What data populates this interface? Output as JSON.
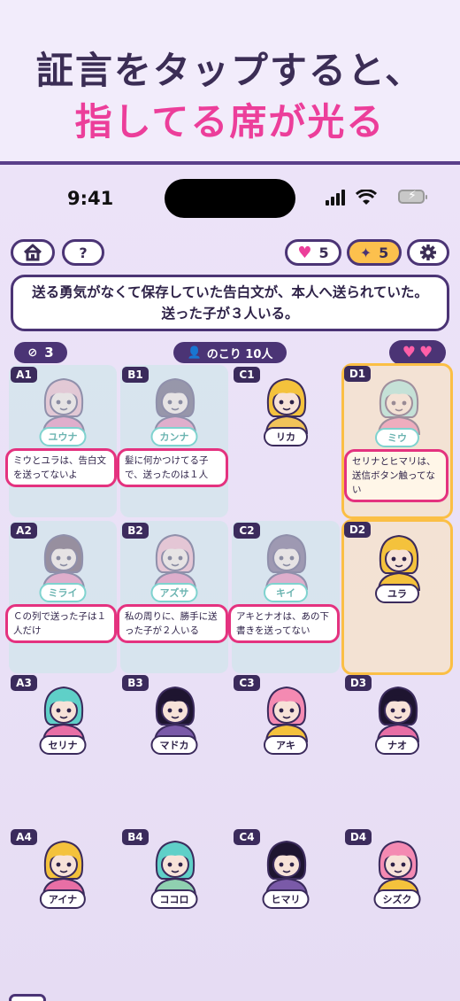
{
  "promo": {
    "line1": "証言をタップすると、",
    "line2": "指してる席が光る"
  },
  "status_bar": {
    "time": "9:41"
  },
  "toolbar": {
    "home_icon": "home-icon",
    "help_label": "?",
    "lives_value": "5",
    "hints_value": "5",
    "settings_icon": "gear-icon"
  },
  "prompt": {
    "text": "送る勇気がなくて保存していた告白文が、本人へ送られていた。送った子が３人いる。"
  },
  "counters": {
    "marked_value": "3",
    "remaining_label": "のこり 10人"
  },
  "hearts": [
    "♥",
    "♥"
  ],
  "seats": [
    {
      "id": "A1",
      "name": "ユウナ",
      "testimony": "ミウとユラは、告白文を送ってないよ",
      "viewed": true,
      "hair": "#f0a8b8",
      "skin": "#f7e2d8",
      "shirt": "#e86fa5"
    },
    {
      "id": "B1",
      "name": "カンナ",
      "testimony": "髪に何かつけてる子で、送ったのは１人",
      "viewed": true,
      "hair": "#4a3a5a",
      "skin": "#f7e2d8",
      "shirt": "#e86fa5"
    },
    {
      "id": "C1",
      "name": "リカ",
      "testimony": "",
      "viewed": false,
      "hair": "#f4c23c",
      "skin": "#f7e2d8",
      "shirt": "#f1c35a"
    },
    {
      "id": "D1",
      "name": "ミウ",
      "testimony": "セリナとヒマリは、送信ボタン触ってない",
      "viewed": true,
      "highlight": true,
      "hair": "#8fe0dc",
      "skin": "#f7e2d8",
      "shirt": "#e86fa5"
    },
    {
      "id": "A2",
      "name": "ミライ",
      "testimony": "Ｃの列で送った子は１人だけ",
      "viewed": true,
      "hair": "#4a2a40",
      "skin": "#f7e2d8",
      "shirt": "#e86fa5"
    },
    {
      "id": "B2",
      "name": "アズサ",
      "testimony": "私の周りに、勝手に送った子が２人いる",
      "viewed": true,
      "hair": "#f3a3b8",
      "skin": "#f7e2d8",
      "shirt": "#e86fa5"
    },
    {
      "id": "C2",
      "name": "キイ",
      "testimony": "アキとナオは、あの下書きを送ってない",
      "viewed": true,
      "hair": "#5a3f6a",
      "skin": "#f7e2d8",
      "shirt": "#e86fa5"
    },
    {
      "id": "D2",
      "name": "ユラ",
      "testimony": "",
      "viewed": false,
      "highlight": true,
      "hair": "#f4c23c",
      "skin": "#f7e2d8",
      "shirt": "#f4c23c"
    },
    {
      "id": "A3",
      "name": "セリナ",
      "testimony": "",
      "viewed": false,
      "hair": "#5fd0c8",
      "skin": "#f7e2d8",
      "shirt": "#e86fa5"
    },
    {
      "id": "B3",
      "name": "マドカ",
      "testimony": "",
      "viewed": false,
      "hair": "#1e1530",
      "skin": "#f7e2d8",
      "shirt": "#7a5aa8"
    },
    {
      "id": "C3",
      "name": "アキ",
      "testimony": "",
      "viewed": false,
      "hair": "#f48ab2",
      "skin": "#f7e2d8",
      "shirt": "#f4c23c"
    },
    {
      "id": "D3",
      "name": "ナオ",
      "testimony": "",
      "viewed": false,
      "hair": "#1e1530",
      "skin": "#f7e2d8",
      "shirt": "#e86fa5"
    },
    {
      "id": "A4",
      "name": "アイナ",
      "testimony": "",
      "viewed": false,
      "hair": "#f4c23c",
      "skin": "#f7e2d8",
      "shirt": "#e86fa5"
    },
    {
      "id": "B4",
      "name": "ココロ",
      "testimony": "",
      "viewed": false,
      "hair": "#5fd0c8",
      "skin": "#f7e2d8",
      "shirt": "#8fd0b0"
    },
    {
      "id": "C4",
      "name": "ヒマリ",
      "testimony": "",
      "viewed": false,
      "hair": "#1e1530",
      "skin": "#f7e2d8",
      "shirt": "#7a5aa8"
    },
    {
      "id": "D4",
      "name": "シズク",
      "testimony": "",
      "viewed": false,
      "hair": "#f48ab2",
      "skin": "#f7e2d8",
      "shirt": "#f4c23c"
    }
  ],
  "colors": {
    "accent_pink": "#ec3e9a",
    "frame_purple": "#4b3475",
    "highlight_gold": "#fbbf45"
  }
}
